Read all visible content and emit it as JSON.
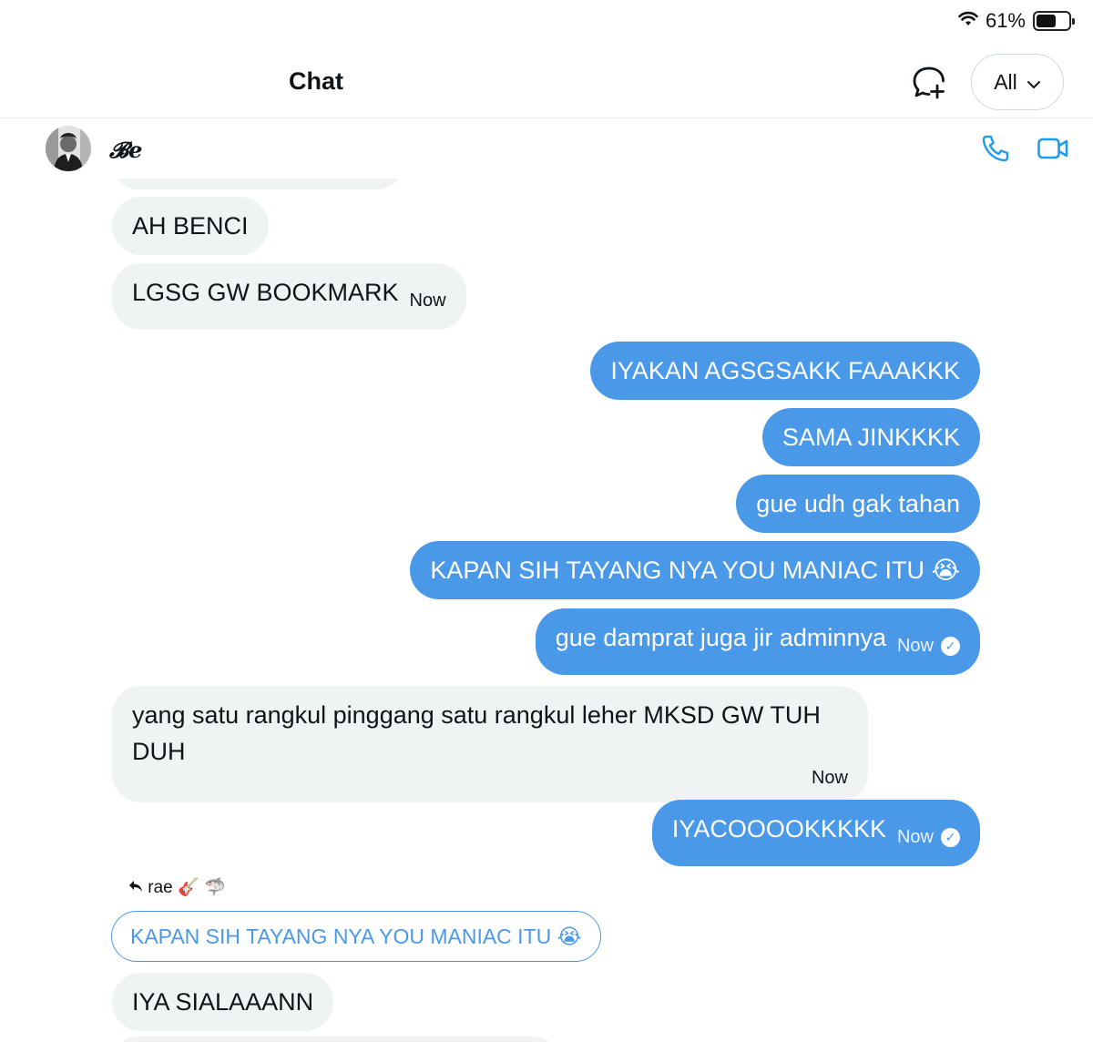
{
  "status": {
    "battery": "61%",
    "battery_level": 0.61
  },
  "header": {
    "title": "Chat",
    "filter_label": "All"
  },
  "conversation": {
    "name": "𝓑e"
  },
  "messages": [
    {
      "dir": "in",
      "text": "AH BENCI"
    },
    {
      "dir": "in",
      "text": "LGSG GW BOOKMARK",
      "time": "Now"
    },
    {
      "dir": "out",
      "text": "IYAKAN AGSGSAKK FAAAKKK"
    },
    {
      "dir": "out",
      "text": "SAMA JINKKKK"
    },
    {
      "dir": "out",
      "text": "gue udh gak tahan"
    },
    {
      "dir": "out",
      "text": "KAPAN SIH TAYANG NYA YOU MANIAC ITU 😭"
    },
    {
      "dir": "out",
      "text": "gue damprat juga jir adminnya",
      "time": "Now"
    },
    {
      "dir": "in",
      "text": "yang satu rangkul pinggang satu rangkul leher MKSD GW TUH DUH",
      "time": "Now"
    },
    {
      "dir": "out",
      "text": "IYACOOOOKKKKK",
      "time": "Now"
    },
    {
      "dir": "in",
      "text": "IYA SIALAAANN"
    }
  ],
  "reply": {
    "label": "rae 🎸 🦈",
    "quoted": "KAPAN SIH TAYANG NYA YOU MANIAC ITU 😭"
  },
  "colors": {
    "outgoing": "#4a99e9",
    "incoming": "#eff3f4",
    "accent": "#1d9bf0"
  },
  "icons": [
    "wifi-icon",
    "battery-icon",
    "new-chat-icon",
    "chevron-down-icon",
    "phone-icon",
    "video-icon",
    "reply-arrow-icon",
    "read-check-icon"
  ]
}
